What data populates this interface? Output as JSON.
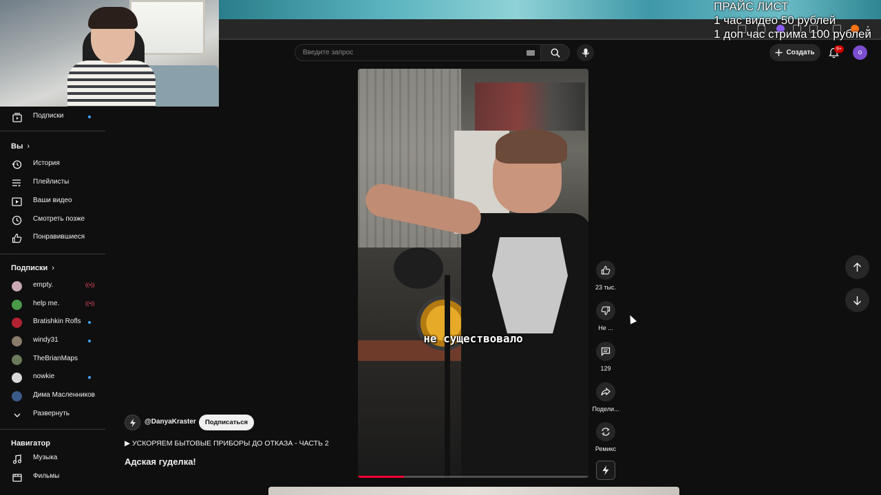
{
  "price_list": {
    "title": "ПРАЙС ЛИСТ",
    "line1": "1 час видео 50 рублей",
    "line2": "1 доп час стрима 100 рублей"
  },
  "search": {
    "placeholder": "Введите запрос"
  },
  "header": {
    "create_label": "Создать",
    "notifications_badge": "9+",
    "account_initial": "o"
  },
  "sidebar": {
    "subscriptions_top": "Подписки",
    "you_section": "Вы",
    "you_items": [
      {
        "label": "История",
        "icon": "history-icon"
      },
      {
        "label": "Плейлисты",
        "icon": "playlists-icon"
      },
      {
        "label": "Ваши видео",
        "icon": "your-videos-icon"
      },
      {
        "label": "Смотреть позже",
        "icon": "watch-later-icon"
      },
      {
        "label": "Понравившиеся",
        "icon": "liked-icon"
      }
    ],
    "subscriptions_section": "Подписки",
    "channels": [
      {
        "name": "empty.",
        "status": "live",
        "color": "#c9a7b5"
      },
      {
        "name": "help me.",
        "status": "live",
        "color": "#4a9a4a"
      },
      {
        "name": "Bratishkin Rofls",
        "status": "new",
        "color": "#b22232"
      },
      {
        "name": "windy31",
        "status": "new",
        "color": "#8a7a6a"
      },
      {
        "name": "TheBrianMaps",
        "status": "none",
        "color": "#6a7a5a"
      },
      {
        "name": "nowkie",
        "status": "new",
        "color": "#d8d8d8"
      },
      {
        "name": "Дима Масленников",
        "status": "none",
        "color": "#3a5a8a"
      }
    ],
    "expand_label": "Развернуть",
    "navigator_section": "Навигатор",
    "navigator_items": [
      {
        "label": "Музыка",
        "icon": "music-icon"
      },
      {
        "label": "Фильмы",
        "icon": "movies-icon"
      }
    ]
  },
  "video": {
    "subtitle": "не существовало",
    "progress": 0.2
  },
  "info": {
    "channel": "@DanyaKraster",
    "subscribe_label": "Подписаться",
    "playlist": "▶ УСКОРЯЕМ БЫТОВЫЕ ПРИБОРЫ ДО ОТКАЗА - ЧАСТЬ 2",
    "title": "Адская гуделка!"
  },
  "actions": {
    "likes": "23 тыс.",
    "dislike": "Не ...",
    "comments": "129",
    "share": "Подели...",
    "remix": "Ремикс"
  },
  "colors": {
    "background": "#0f0f0f",
    "accent_red": "#ff0033",
    "account": "#7b4dcf"
  }
}
